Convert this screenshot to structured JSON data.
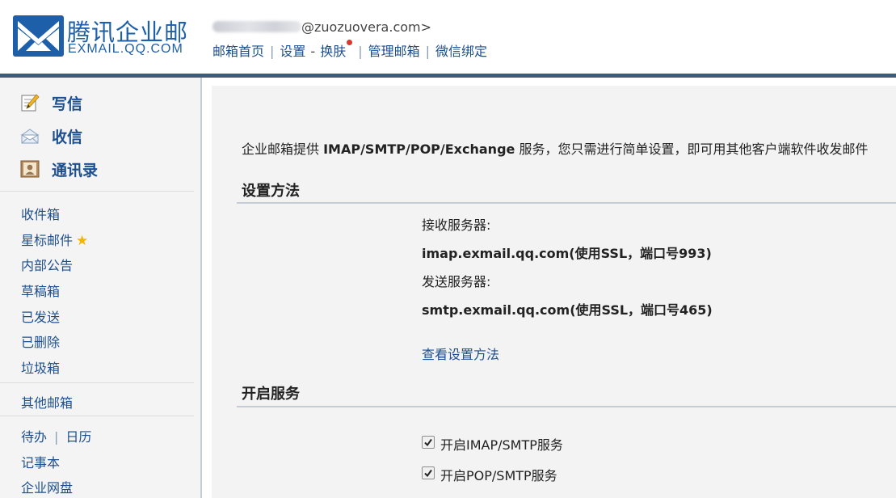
{
  "brand": {
    "name_cn": "腾讯企业邮",
    "domain": "EXMAIL.QQ.COM",
    "color": "#1d5fa9"
  },
  "account": {
    "email_suffix": "@zuozuovera.com>"
  },
  "topnav": {
    "home": "邮箱首页",
    "settings": "设置",
    "skin": "换肤",
    "manage": "管理邮箱",
    "wechat": "微信绑定"
  },
  "sidebar": {
    "actions": {
      "compose": "写信",
      "inbox_check": "收信",
      "contacts": "通讯录"
    },
    "folders": {
      "inbox": "收件箱",
      "starred": "星标邮件",
      "bulletin": "内部公告",
      "drafts": "草稿箱",
      "sent": "已发送",
      "deleted": "已删除",
      "spam": "垃圾箱"
    },
    "other_mailbox": "其他邮箱",
    "tools": {
      "todo": "待办",
      "calendar": "日历",
      "notes": "记事本",
      "disk": "企业网盘"
    }
  },
  "main": {
    "intro": {
      "prefix": "企业邮箱提供 ",
      "protocols": "IMAP/SMTP/POP/Exchange",
      "suffix": " 服务，您只需进行简单设置，即可用其他客户端软件收发邮件"
    },
    "setup": {
      "title": "设置方法",
      "incoming_label": "接收服务器:",
      "incoming_value": "imap.exmail.qq.com(使用SSL，端口号993)",
      "outgoing_label": "发送服务器:",
      "outgoing_value": "smtp.exmail.qq.com(使用SSL，端口号465)",
      "help_link": "查看设置方法"
    },
    "services": {
      "title": "开启服务",
      "imap": {
        "label": "开启IMAP/SMTP服务",
        "checked": true
      },
      "pop": {
        "label": "开启POP/SMTP服务",
        "checked": true
      }
    }
  }
}
